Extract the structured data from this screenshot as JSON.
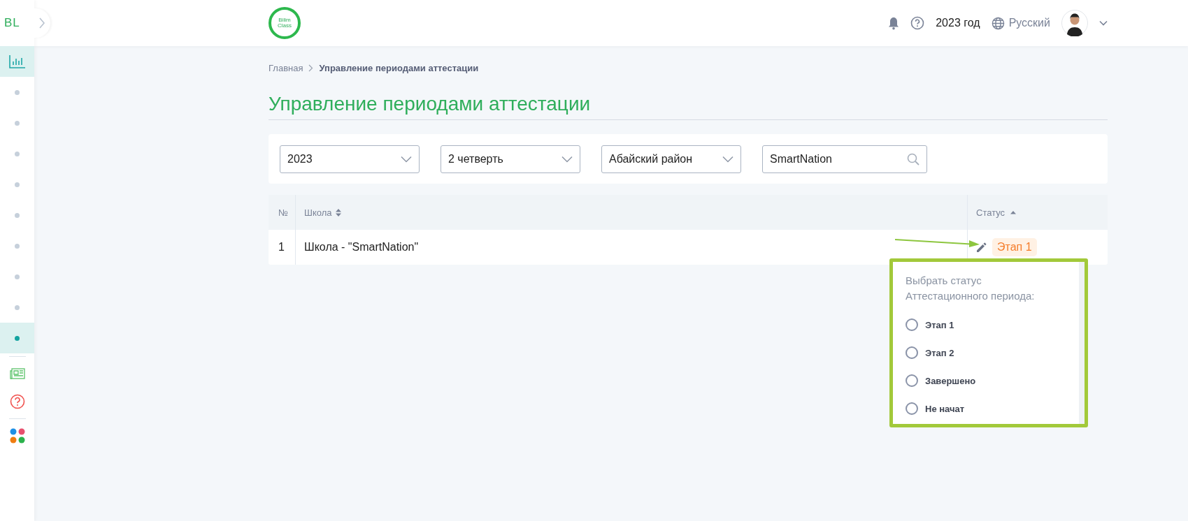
{
  "sidebar": {
    "logo": "BL",
    "items": [
      {
        "kind": "chart",
        "selected": true
      },
      {
        "kind": "dot",
        "selected": false
      },
      {
        "kind": "dot",
        "selected": false
      },
      {
        "kind": "dot",
        "selected": false
      },
      {
        "kind": "dot",
        "selected": false
      },
      {
        "kind": "dot",
        "selected": false
      },
      {
        "kind": "dot",
        "selected": false
      },
      {
        "kind": "dot",
        "selected": false
      },
      {
        "kind": "dot",
        "selected": false
      },
      {
        "kind": "dot",
        "selected": true
      }
    ],
    "tools": [
      {
        "kind": "divider"
      },
      {
        "kind": "news"
      },
      {
        "kind": "help"
      },
      {
        "kind": "divider"
      },
      {
        "kind": "apps"
      }
    ]
  },
  "header": {
    "logo_lines": [
      "Bilim",
      "Class"
    ],
    "year": "2023 год",
    "language": "Русский"
  },
  "breadcrumb": [
    "Главная",
    "Управление периодами аттестации"
  ],
  "title": "Управление периодами аттестации",
  "filters": [
    {
      "kind": "select",
      "value": "2023"
    },
    {
      "kind": "select",
      "value": "2 четверть"
    },
    {
      "kind": "select",
      "value": "Абайский район"
    },
    {
      "kind": "search",
      "value": "SmartNation"
    }
  ],
  "table": {
    "columns": [
      "№",
      "Школа",
      "Статус"
    ],
    "rows": [
      {
        "number": "1",
        "school": "Школа - \"SmartNation\"",
        "status": "Этап 1"
      }
    ]
  },
  "status_popup": {
    "title": "Выбрать статус Аттестационного периода:",
    "options": [
      {
        "label": "Этап 1",
        "selected": false
      },
      {
        "label": "Этап 2",
        "selected": false
      },
      {
        "label": "Завершено",
        "selected": false
      },
      {
        "label": "Не начат",
        "selected": false
      }
    ]
  }
}
